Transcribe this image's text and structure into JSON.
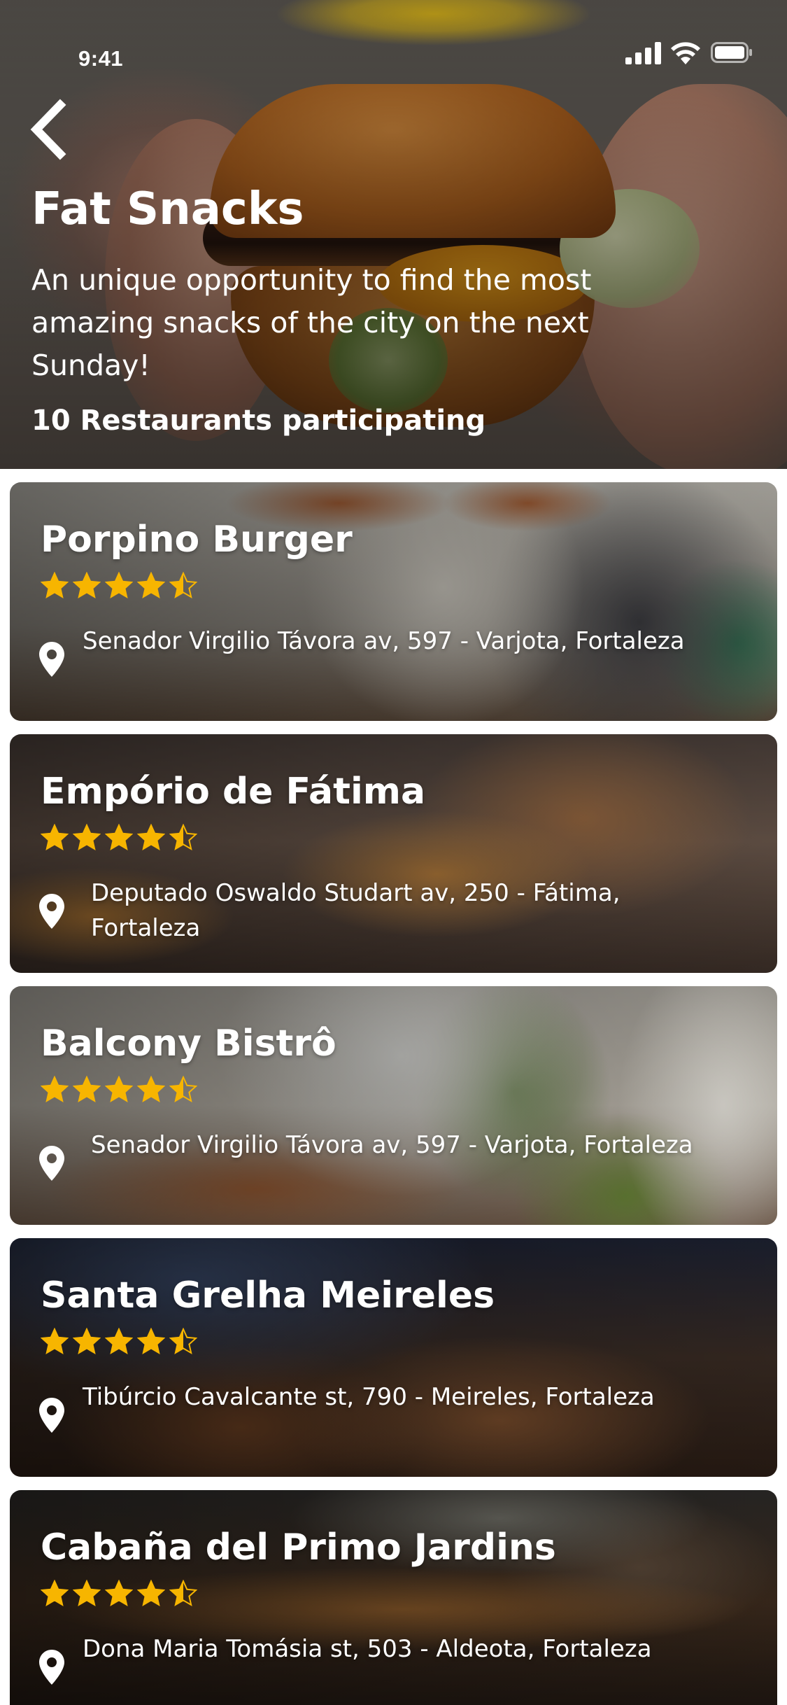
{
  "status_bar": {
    "time": "9:41"
  },
  "hero": {
    "title": "Fat Snacks",
    "description": "An unique opportunity to find the most amazing snacks of the city on the next Sunday!",
    "participants": "10 Restaurants participating"
  },
  "colors": {
    "star": "#f7b500",
    "text": "#ffffff"
  },
  "restaurants": [
    {
      "name": "Porpino Burger",
      "rating": 4.5,
      "address": "Senador Virgilio Távora av, 597 - Varjota, Fortaleza"
    },
    {
      "name": "Empório de Fátima",
      "rating": 4.5,
      "address": "Deputado Oswaldo Studart av, 250 - Fátima, Fortaleza"
    },
    {
      "name": "Balcony Bistrô",
      "rating": 4.5,
      "address": "Senador Virgilio Távora av, 597 - Varjota, Fortaleza"
    },
    {
      "name": "Santa Grelha Meireles",
      "rating": 4.5,
      "address": "Tibúrcio Cavalcante st, 790 - Meireles, Fortaleza"
    },
    {
      "name": "Cabaña del Primo Jardins",
      "rating": 4.5,
      "address": "Dona Maria Tomásia st, 503 - Aldeota, Fortaleza"
    }
  ]
}
